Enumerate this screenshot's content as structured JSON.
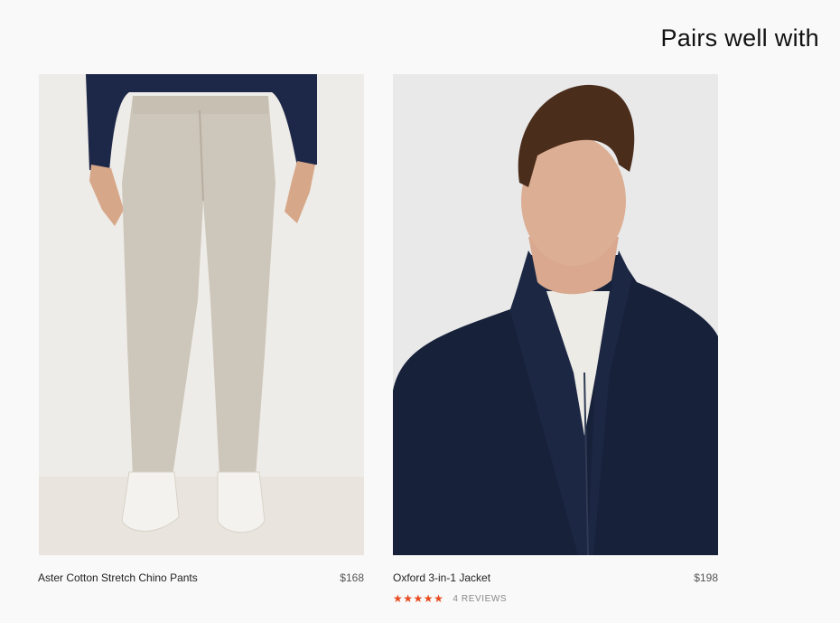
{
  "section": {
    "title": "Pairs well with"
  },
  "products": [
    {
      "name": "Aster Cotton Stretch Chino Pants",
      "price": "$168",
      "image_alt": "Model wearing beige chino pants and white sneakers"
    },
    {
      "name": "Oxford 3-in-1 Jacket",
      "price": "$198",
      "image_alt": "Model wearing navy zip-up jacket",
      "rating": {
        "stars": 5,
        "max": 5,
        "reviews_label": "4 REVIEWS"
      }
    }
  ],
  "colors": {
    "accent_star": "#e8491d",
    "background": "#f9f9f9"
  },
  "icons": {
    "star": "star-icon"
  }
}
